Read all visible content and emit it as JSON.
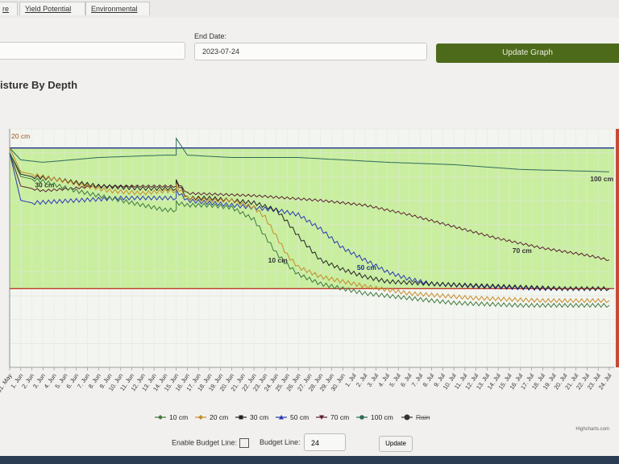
{
  "tabs": [
    {
      "label": "re"
    },
    {
      "label": "Yield Potential"
    },
    {
      "label": "Environmental"
    }
  ],
  "end_date": {
    "label": "End Date:",
    "value": "2023-07-24"
  },
  "update_graph_label": "Update Graph",
  "title": "isture By Depth",
  "controls": {
    "enable_budget_label": "Enable Budget Line:",
    "budget_line_label": "Budget Line:",
    "budget_value": "24",
    "update_label": "Update"
  },
  "credit": "Highcharts.com",
  "colors": {
    "plot_band": "#c9eea0",
    "budget_line": "#c0392b",
    "accent_button": "#4d6a1b"
  },
  "chart_data": {
    "type": "line",
    "x_categories": [
      "31. May",
      "1. Jun",
      "2. Jun",
      "3. Jun",
      "4. Jun",
      "5. Jun",
      "6. Jun",
      "7. Jun",
      "8. Jun",
      "9. Jun",
      "10. Jun",
      "11. Jun",
      "12. Jun",
      "13. Jun",
      "14. Jun",
      "15. Jun",
      "16. Jun",
      "17. Jun",
      "18. Jun",
      "19. Jun",
      "20. Jun",
      "21. Jun",
      "22. Jun",
      "23. Jun",
      "24. Jun",
      "25. Jun",
      "26. Jun",
      "27. Jun",
      "28. Jun",
      "29. Jun",
      "30. Jun",
      "1. Jul",
      "2. Jul",
      "3. Jul",
      "4. Jul",
      "5. Jul",
      "6. Jul",
      "7. Jul",
      "8. Jul",
      "9. Jul",
      "10. Jul",
      "11. Jul",
      "12. Jul",
      "13. Jul",
      "14. Jul",
      "15. Jul",
      "16. Jul",
      "17. Jul",
      "18. Jul",
      "19. Jul",
      "20. Jul",
      "21. Jul",
      "22. Jul",
      "23. Jul",
      "24. Jul"
    ],
    "x_first_partial": "31. May",
    "y_axis_labels": "none visible",
    "y_range_note": "relative moisture, 0 (bottom) to 100 (top)",
    "band": {
      "from": 33,
      "to": 92
    },
    "budget_line_value": 33,
    "top_line_value": 92,
    "legend": [
      {
        "name": "10 cm",
        "color": "#3f7a3f",
        "marker": "diamond"
      },
      {
        "name": "20 cm",
        "color": "#c58b2a",
        "marker": "diamond"
      },
      {
        "name": "30 cm",
        "color": "#222222",
        "marker": "square"
      },
      {
        "name": "50 cm",
        "color": "#2a3ab0",
        "marker": "triangle"
      },
      {
        "name": "70 cm",
        "color": "#5a2030",
        "marker": "triangle-down"
      },
      {
        "name": "100 cm",
        "color": "#2f6a5a",
        "marker": "circle"
      },
      {
        "name": "Rain",
        "color": "#333333",
        "marker": "circle",
        "hidden": true
      }
    ],
    "series": [
      {
        "name": "100 cm",
        "label": "100 cm",
        "label_at": 53,
        "points": [
          [
            0,
            92
          ],
          [
            1,
            87
          ],
          [
            3,
            86
          ],
          [
            8,
            88
          ],
          [
            14,
            89
          ],
          [
            15,
            89
          ],
          [
            15,
            96
          ],
          [
            16,
            89
          ],
          [
            20,
            88
          ],
          [
            26,
            88
          ],
          [
            30,
            87
          ],
          [
            34,
            86
          ],
          [
            40,
            85
          ],
          [
            46,
            83
          ],
          [
            54,
            82
          ]
        ]
      },
      {
        "name": "70 cm",
        "label": "70 cm",
        "label_at": 46,
        "points": [
          [
            0,
            90
          ],
          [
            1,
            76
          ],
          [
            3,
            74
          ],
          [
            8,
            76
          ],
          [
            14,
            76
          ],
          [
            15,
            76
          ],
          [
            15,
            78
          ],
          [
            16,
            73
          ],
          [
            22,
            72
          ],
          [
            28,
            70
          ],
          [
            32,
            68
          ],
          [
            36,
            64
          ],
          [
            40,
            59
          ],
          [
            44,
            54
          ],
          [
            48,
            50
          ],
          [
            52,
            47
          ],
          [
            54,
            45
          ]
        ]
      },
      {
        "name": "50 cm",
        "label": "50 cm",
        "label_at": 32,
        "points": [
          [
            0,
            90
          ],
          [
            1,
            70
          ],
          [
            2,
            69
          ],
          [
            6,
            70
          ],
          [
            10,
            71
          ],
          [
            14,
            71
          ],
          [
            15,
            71
          ],
          [
            15,
            74
          ],
          [
            16,
            70
          ],
          [
            20,
            68
          ],
          [
            24,
            66
          ],
          [
            26,
            64
          ],
          [
            28,
            58
          ],
          [
            30,
            50
          ],
          [
            32,
            45
          ],
          [
            34,
            40
          ],
          [
            36,
            37
          ],
          [
            38,
            35
          ],
          [
            42,
            34
          ],
          [
            48,
            33
          ],
          [
            54,
            33
          ]
        ]
      },
      {
        "name": "30 cm",
        "label": "30 cm",
        "label_at": 3,
        "points": [
          [
            0,
            90
          ],
          [
            1,
            81
          ],
          [
            2,
            80
          ],
          [
            4,
            79
          ],
          [
            8,
            76
          ],
          [
            12,
            75
          ],
          [
            14,
            75
          ],
          [
            15,
            75
          ],
          [
            15,
            78
          ],
          [
            16,
            71
          ],
          [
            18,
            71
          ],
          [
            20,
            70
          ],
          [
            22,
            69
          ],
          [
            24,
            66
          ],
          [
            25,
            61
          ],
          [
            26,
            55
          ],
          [
            27,
            50
          ],
          [
            28,
            45
          ],
          [
            30,
            41
          ],
          [
            32,
            38
          ],
          [
            34,
            36
          ],
          [
            38,
            35
          ],
          [
            44,
            34
          ],
          [
            50,
            33
          ],
          [
            54,
            33
          ]
        ]
      },
      {
        "name": "20 cm",
        "label": "",
        "label_at": null,
        "points": [
          [
            0,
            92
          ],
          [
            1,
            82
          ],
          [
            3,
            80
          ],
          [
            6,
            77
          ],
          [
            9,
            74
          ],
          [
            12,
            73
          ],
          [
            14,
            74
          ],
          [
            15,
            74
          ],
          [
            15,
            76
          ],
          [
            16,
            71
          ],
          [
            18,
            70
          ],
          [
            20,
            70
          ],
          [
            22,
            67
          ],
          [
            23,
            63
          ],
          [
            24,
            55
          ],
          [
            25,
            47
          ],
          [
            26,
            42
          ],
          [
            28,
            38
          ],
          [
            30,
            36
          ],
          [
            32,
            34
          ],
          [
            36,
            31
          ],
          [
            42,
            29
          ],
          [
            48,
            28
          ],
          [
            54,
            28
          ]
        ]
      },
      {
        "name": "10 cm",
        "label": "10 cm",
        "label_at": 24,
        "points": [
          [
            0,
            90
          ],
          [
            1,
            80
          ],
          [
            3,
            78
          ],
          [
            6,
            74
          ],
          [
            9,
            71
          ],
          [
            12,
            68
          ],
          [
            14,
            66
          ],
          [
            15,
            66
          ],
          [
            15,
            69
          ],
          [
            16,
            68
          ],
          [
            18,
            68
          ],
          [
            20,
            67
          ],
          [
            22,
            62
          ],
          [
            23,
            55
          ],
          [
            24,
            48
          ],
          [
            25,
            43
          ],
          [
            26,
            39
          ],
          [
            28,
            35
          ],
          [
            30,
            33
          ],
          [
            32,
            31
          ],
          [
            36,
            29
          ],
          [
            40,
            27
          ],
          [
            46,
            26
          ],
          [
            54,
            26
          ]
        ]
      }
    ],
    "top_left_series_label": "20 cm"
  }
}
